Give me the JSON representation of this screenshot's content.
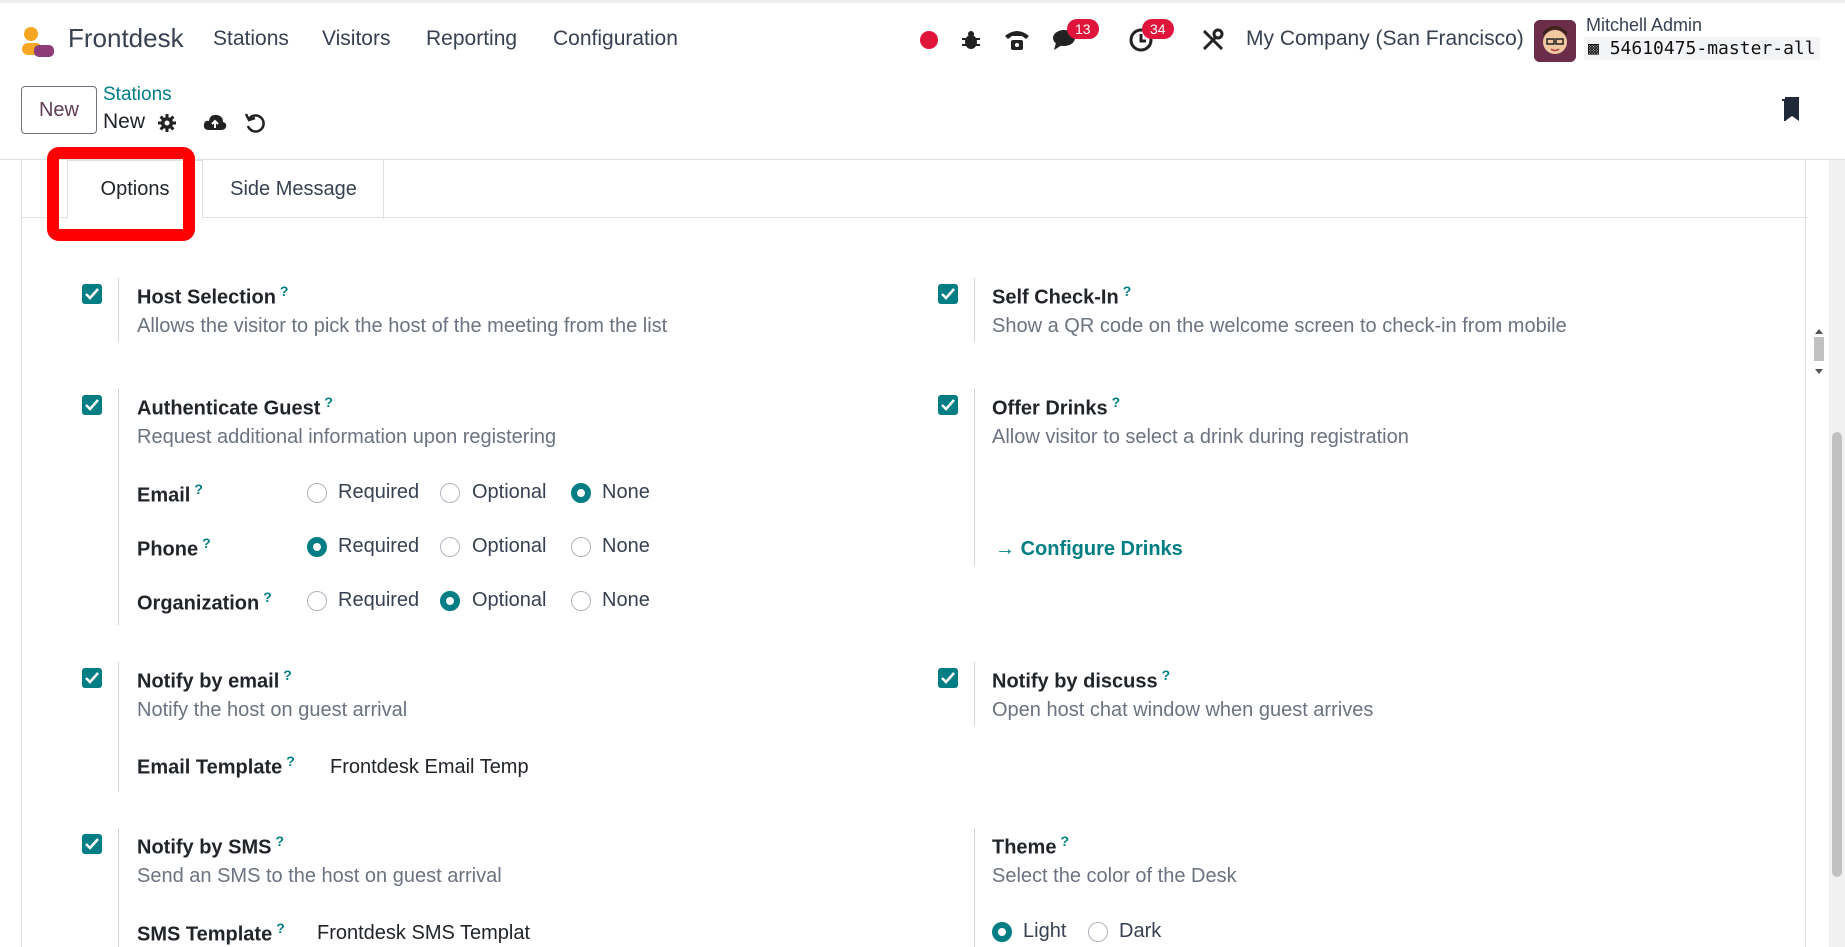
{
  "app": {
    "name": "Frontdesk",
    "menus": [
      "Stations",
      "Visitors",
      "Reporting",
      "Configuration"
    ],
    "messages_count": "13",
    "activities_count": "34",
    "company": "My Company (San Francisco)",
    "user": "Mitchell Admin",
    "database": "54610475-master-all"
  },
  "control": {
    "new_label": "New",
    "breadcrumb_parent": "Stations",
    "breadcrumb_current": "New"
  },
  "tabs": [
    "Options",
    "Side Message"
  ],
  "fields": {
    "host_selection": {
      "title": "Host Selection",
      "desc": "Allows the visitor to pick the host of the meeting from the list",
      "checked": true
    },
    "self_checkin": {
      "title": "Self Check-In",
      "desc": "Show a QR code on the welcome screen to check-in from mobile",
      "checked": true
    },
    "authenticate_guest": {
      "title": "Authenticate Guest",
      "desc": "Request additional information upon registering",
      "checked": true
    },
    "offer_drinks": {
      "title": "Offer Drinks",
      "desc": "Allow visitor to select a drink during registration",
      "checked": true,
      "link": "Configure Drinks"
    },
    "email": {
      "label": "Email",
      "selected": "None"
    },
    "phone": {
      "label": "Phone",
      "selected": "Required"
    },
    "organization": {
      "label": "Organization",
      "selected": "Optional"
    },
    "radio_options": [
      "Required",
      "Optional",
      "None"
    ],
    "notify_email": {
      "title": "Notify by email",
      "desc": "Notify the host on guest arrival",
      "checked": true
    },
    "notify_discuss": {
      "title": "Notify by discuss",
      "desc": "Open host chat window when guest arrives",
      "checked": true
    },
    "email_template": {
      "label": "Email Template",
      "value": "Frontdesk Email Temp"
    },
    "notify_sms": {
      "title": "Notify by SMS",
      "desc": "Send an SMS to the host on guest arrival",
      "checked": true
    },
    "sms_template": {
      "label": "SMS Template",
      "value": "Frontdesk SMS Templat"
    },
    "theme": {
      "title": "Theme",
      "desc": "Select the color of the Desk",
      "options": [
        "Light",
        "Dark"
      ],
      "selected": "Light"
    }
  },
  "colors": {
    "accent": "#017e84",
    "brand": "#5f3b55",
    "badge": "#e0153c",
    "highlight": "#ff0000"
  }
}
